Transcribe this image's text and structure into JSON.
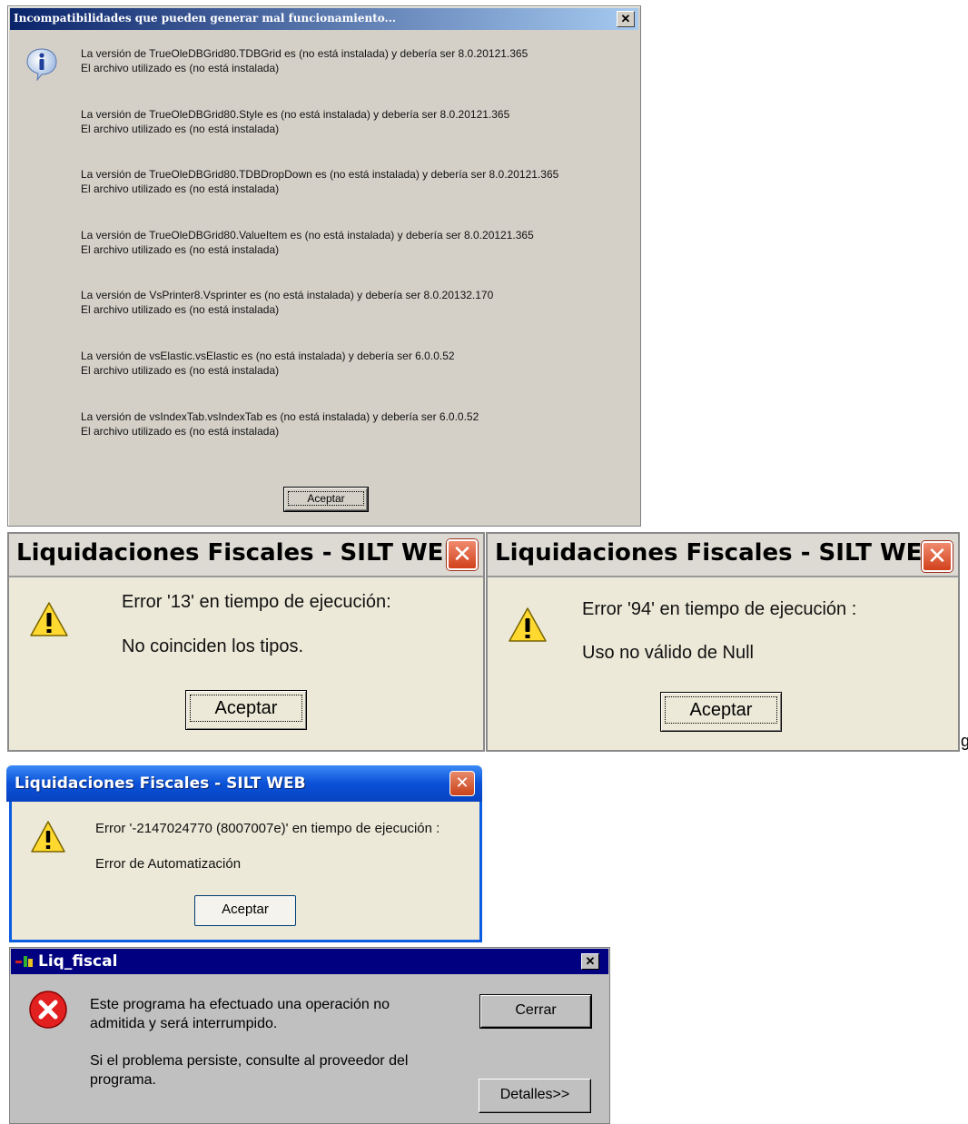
{
  "dialog1": {
    "title": "Incompatibilidades que pueden generar mal funcionamiento...",
    "close_glyph": "✕",
    "icon": "info-icon",
    "messages": [
      {
        "line1": "La versión de TrueOleDBGrid80.TDBGrid es (no está instalada) y debería ser 8.0.20121.365",
        "line2": "El archivo utilizado es (no está instalada)"
      },
      {
        "line1": "La versión de TrueOleDBGrid80.Style es (no está instalada) y debería ser 8.0.20121.365",
        "line2": "El archivo utilizado es (no está instalada)"
      },
      {
        "line1": "La versión de TrueOleDBGrid80.TDBDropDown es (no está instalada) y debería ser 8.0.20121.365",
        "line2": "El archivo utilizado es (no está instalada)"
      },
      {
        "line1": "La versión de TrueOleDBGrid80.ValueItem es (no está instalada) y debería ser 8.0.20121.365",
        "line2": "El archivo utilizado es (no está instalada)"
      },
      {
        "line1": "La versión de VsPrinter8.Vsprinter es (no está instalada) y debería ser 8.0.20132.170",
        "line2": "El archivo utilizado es (no está instalada)"
      },
      {
        "line1": "La versión de vsElastic.vsElastic es (no está instalada) y debería ser 6.0.0.52",
        "line2": "El archivo utilizado es (no está instalada)"
      },
      {
        "line1": "La versión de vsIndexTab.vsIndexTab es (no está instalada) y debería ser 6.0.0.52",
        "line2": "El archivo utilizado es (no está instalada)"
      }
    ],
    "ok_label": "Aceptar"
  },
  "dialog2": {
    "title": "Liquidaciones Fiscales - SILT WEB",
    "close_glyph": "✕",
    "icon": "warning-icon",
    "line1": "Error '13' en tiempo de ejecución:",
    "line2": "No coinciden los tipos.",
    "ok_label": "Aceptar"
  },
  "dialog3": {
    "title": "Liquidaciones Fiscales - SILT WEB",
    "close_glyph": "✕",
    "icon": "warning-icon",
    "line1": "Error '94' en tiempo de ejecución :",
    "line2": "Uso no válido de Null",
    "ok_label": "Aceptar",
    "stray_char": "g"
  },
  "dialog4": {
    "title": "Liquidaciones Fiscales - SILT WEB",
    "close_glyph": "✕",
    "icon": "warning-icon",
    "line1": "Error '-2147024770 (8007007e)' en tiempo de ejecución :",
    "line2": "Error de Automatización",
    "ok_label": "Aceptar"
  },
  "dialog5": {
    "title": "Liq_fiscal",
    "close_glyph": "✕",
    "icon": "error-icon",
    "para1_line1": "Este programa ha efectuado una operación no",
    "para1_line2": "admitida y será interrumpido.",
    "para2_line1": "Si el problema persiste, consulte al proveedor del",
    "para2_line2": "programa.",
    "close_label": "Cerrar",
    "details_label": "Detalles>>"
  }
}
